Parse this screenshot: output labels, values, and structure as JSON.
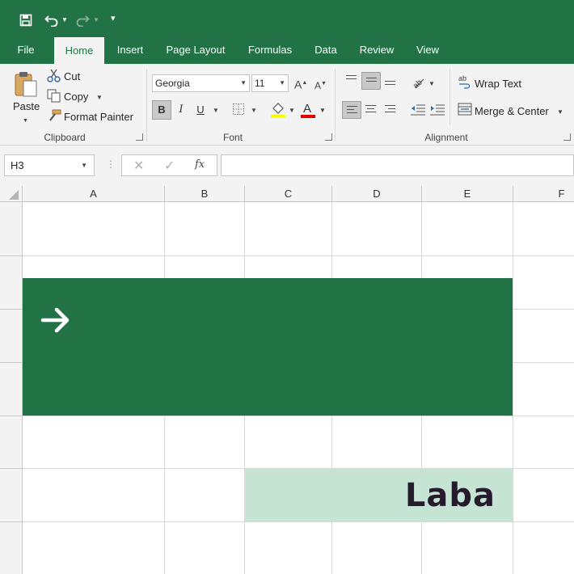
{
  "tabs": [
    {
      "label": "File"
    },
    {
      "label": "Home"
    },
    {
      "label": "Insert"
    },
    {
      "label": "Page Layout"
    },
    {
      "label": "Formulas"
    },
    {
      "label": "Data"
    },
    {
      "label": "Review"
    },
    {
      "label": "View"
    }
  ],
  "clipboard": {
    "paste_label": "Paste",
    "cut_label": "Cut",
    "copy_label": "Copy",
    "format_painter_label": "Format Painter",
    "group_label": "Clipboard"
  },
  "font": {
    "family": "Georgia",
    "size": "11",
    "bold": "B",
    "italic": "I",
    "underline": "U",
    "group_label": "Font"
  },
  "alignment": {
    "wrap_text_label": "Wrap Text",
    "merge_center_label": "Merge & Center",
    "group_label": "Alignment"
  },
  "formula_bar": {
    "name_box": "H3",
    "fx": "fx",
    "formula": ""
  },
  "columns": [
    "A",
    "B",
    "C",
    "D",
    "E",
    "F"
  ],
  "sheet": {
    "logo_text": "Laba",
    "banner_color": "#217346",
    "logo_cell_color": "#c5e4d3"
  },
  "colors": {
    "accent": "#217346"
  }
}
